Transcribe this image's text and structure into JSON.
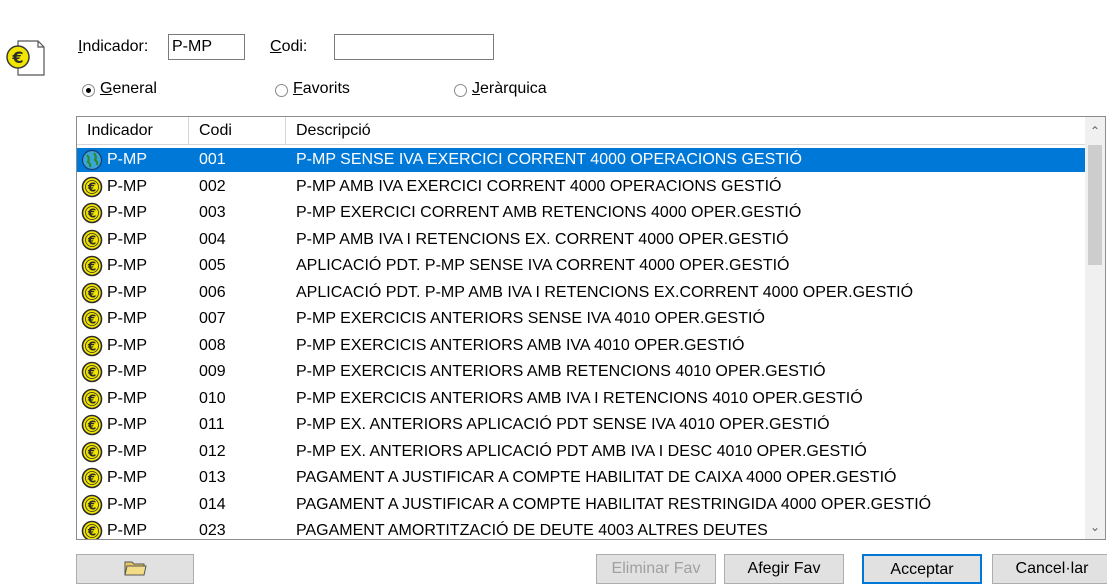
{
  "form": {
    "indicador_label_u": "I",
    "indicador_label_rest": "ndicador:",
    "indicador_value": "P-MP",
    "codi_label_u": "C",
    "codi_label_rest": "odi:",
    "codi_value": ""
  },
  "radios": [
    {
      "u": "G",
      "rest": "eneral",
      "selected": true
    },
    {
      "u": "F",
      "rest": "avorits",
      "selected": false
    },
    {
      "u": "J",
      "rest": "eràrquica",
      "selected": false
    }
  ],
  "list": {
    "headers": {
      "indicador": "Indicador",
      "codi": "Codi",
      "descripcio": "Descripció"
    },
    "rows": [
      {
        "indicador": "P-MP",
        "codi": "001",
        "descripcio": "P-MP SENSE IVA EXERCICI CORRENT 4000 OPERACIONS GESTIÓ",
        "selected": true
      },
      {
        "indicador": "P-MP",
        "codi": "002",
        "descripcio": "P-MP AMB IVA EXERCICI CORRENT 4000 OPERACIONS GESTIÓ"
      },
      {
        "indicador": "P-MP",
        "codi": "003",
        "descripcio": "P-MP EXERCICI CORRENT AMB RETENCIONS 4000 OPER.GESTIÓ"
      },
      {
        "indicador": "P-MP",
        "codi": "004",
        "descripcio": "P-MP AMB IVA I RETENCIONS EX. CORRENT 4000 OPER.GESTIÓ"
      },
      {
        "indicador": "P-MP",
        "codi": "005",
        "descripcio": "APLICACIÓ PDT. P-MP SENSE IVA CORRENT 4000 OPER.GESTIÓ"
      },
      {
        "indicador": "P-MP",
        "codi": "006",
        "descripcio": "APLICACIÓ PDT. P-MP AMB IVA I RETENCIONS EX.CORRENT 4000 OPER.GESTIÓ"
      },
      {
        "indicador": "P-MP",
        "codi": "007",
        "descripcio": "P-MP EXERCICIS ANTERIORS SENSE IVA 4010 OPER.GESTIÓ"
      },
      {
        "indicador": "P-MP",
        "codi": "008",
        "descripcio": "P-MP EXERCICIS ANTERIORS AMB IVA 4010 OPER.GESTIÓ"
      },
      {
        "indicador": "P-MP",
        "codi": "009",
        "descripcio": "P-MP EXERCICIS ANTERIORS AMB RETENCIONS 4010 OPER.GESTIÓ"
      },
      {
        "indicador": "P-MP",
        "codi": "010",
        "descripcio": "P-MP EXERCICIS ANTERIORS AMB IVA I RETENCIONS 4010 OPER.GESTIÓ"
      },
      {
        "indicador": "P-MP",
        "codi": "011",
        "descripcio": "P-MP EX. ANTERIORS APLICACIÓ PDT SENSE IVA 4010 OPER.GESTIÓ"
      },
      {
        "indicador": "P-MP",
        "codi": "012",
        "descripcio": "P-MP EX. ANTERIORS APLICACIÓ PDT AMB IVA I DESC 4010 OPER.GESTIÓ"
      },
      {
        "indicador": "P-MP",
        "codi": "013",
        "descripcio": "PAGAMENT A JUSTIFICAR A COMPTE HABILITAT DE CAIXA 4000 OPER.GESTIÓ"
      },
      {
        "indicador": "P-MP",
        "codi": "014",
        "descripcio": "PAGAMENT A JUSTIFICAR A COMPTE HABILITAT RESTRINGIDA 4000 OPER.GESTIÓ"
      },
      {
        "indicador": "P-MP",
        "codi": "023",
        "descripcio": "PAGAMENT AMORTITZACIÓ DE DEUTE 4003 ALTRES DEUTES"
      }
    ]
  },
  "buttons": {
    "eliminar_fav": "Eliminar Fav",
    "afegir_fav": "Afegir Fav",
    "acceptar": "Acceptar",
    "cancellar": "Cancel·lar"
  },
  "icons": {
    "window_icon": "euro-document-icon",
    "row_icon": "euro-coin-icon",
    "selected_row_icon": "globe-icon",
    "toolbar_icon": "folder-icon"
  }
}
